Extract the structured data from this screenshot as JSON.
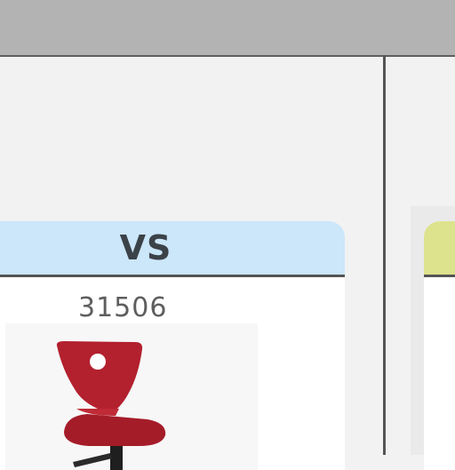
{
  "comparison": {
    "left_card": {
      "header_label": "VS",
      "product_number": "31506",
      "image_icon": "red-chair-image",
      "header_color": "#cce6fa"
    },
    "right_card": {
      "header_color": "#dde28c"
    }
  },
  "colors": {
    "top_bar": "#b3b3b3",
    "divider": "#555555",
    "chair_red": "#b3202e"
  }
}
